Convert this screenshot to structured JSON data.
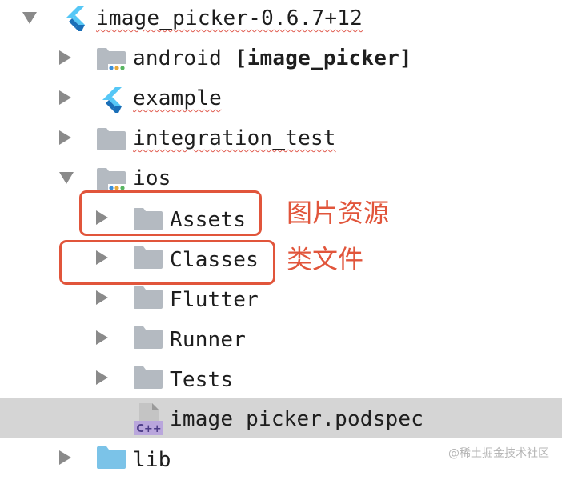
{
  "tree": {
    "root_label": "image_picker-0.6.7+12",
    "android_label": "android",
    "android_module": "[image_picker]",
    "example_label": "example",
    "integration_test_label": "integration_test",
    "ios_label": "ios",
    "assets_label": "Assets",
    "classes_label": "Classes",
    "flutter_label": "Flutter",
    "runner_label": "Runner",
    "tests_label": "Tests",
    "podspec_label": "image_picker.podspec",
    "podspec_badge": "C++",
    "lib_label": "lib"
  },
  "annotations": {
    "assets_note": "图片资源",
    "classes_note": "类文件"
  },
  "watermark": "@稀土掘金技术社区",
  "colors": {
    "folder": "#b4bac1",
    "folder_lib": "#7bc3e8",
    "flutter_light": "#56c7f6",
    "flutter_dark": "#1a6fb8",
    "annotation": "#e1553b",
    "selection": "#d5d5d5"
  },
  "icons": {
    "root": "flutter-icon",
    "android": "android-module-folder-icon",
    "example": "flutter-icon",
    "ios": "ios-module-folder-icon",
    "folders": "folder-icon",
    "podspec": "cpp-file-icon",
    "lib": "source-folder-icon"
  }
}
